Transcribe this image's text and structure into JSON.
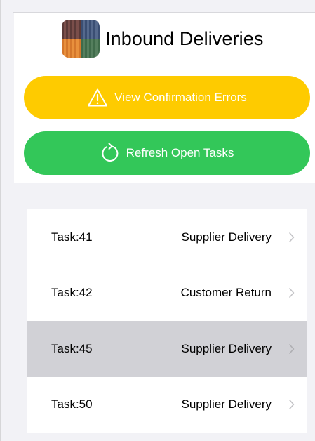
{
  "header": {
    "title": "Inbound Deliveries",
    "app_icon": "shipping-containers-icon"
  },
  "actions": {
    "errors_label": "View Confirmation Errors",
    "errors_icon": "warning-triangle-icon",
    "errors_color": "#fecb00",
    "refresh_label": "Refresh Open Tasks",
    "refresh_icon": "refresh-icon",
    "refresh_color": "#33c759"
  },
  "tasks": [
    {
      "task": "Task:41",
      "type": "Supplier Delivery",
      "selected": false
    },
    {
      "task": "Task:42",
      "type": "Customer Return",
      "selected": false
    },
    {
      "task": "Task:45",
      "type": "Supplier Delivery",
      "selected": true
    },
    {
      "task": "Task:50",
      "type": "Supplier Delivery",
      "selected": false
    }
  ]
}
